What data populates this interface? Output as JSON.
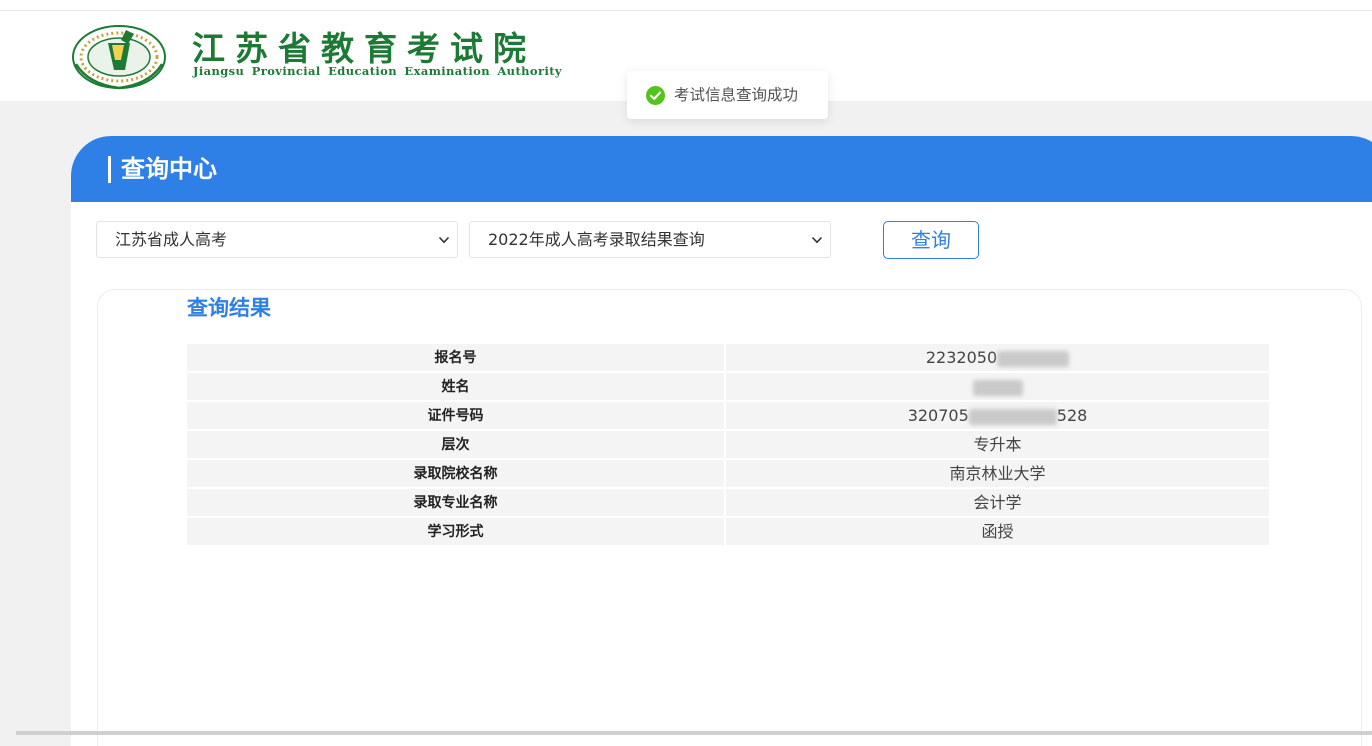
{
  "header": {
    "brand_cn": "江苏省教育考试院",
    "brand_en": "Jiangsu Provincial Education Examination Authority",
    "logo_icon": "seal-logo-icon"
  },
  "toast": {
    "icon": "check-circle-icon",
    "text": "考试信息查询成功",
    "color": "#52c41a"
  },
  "panel": {
    "title": "查询中心",
    "accent": "#2f80e6",
    "select1": {
      "value": "江苏省成人高考"
    },
    "select2": {
      "value": "2022年成人高考录取结果查询"
    },
    "query_button": "查询"
  },
  "result": {
    "title": "查询结果",
    "rows": [
      {
        "label": "报名号",
        "value": "2232050",
        "masked": true
      },
      {
        "label": "姓名",
        "value": "",
        "masked": true
      },
      {
        "label": "证件号码",
        "value_prefix": "320705",
        "value_suffix": "528",
        "masked": true
      },
      {
        "label": "层次",
        "value": "专升本"
      },
      {
        "label": "录取院校名称",
        "value": "南京林业大学"
      },
      {
        "label": "录取专业名称",
        "value": "会计学"
      },
      {
        "label": "学习形式",
        "value": "函授"
      }
    ]
  }
}
